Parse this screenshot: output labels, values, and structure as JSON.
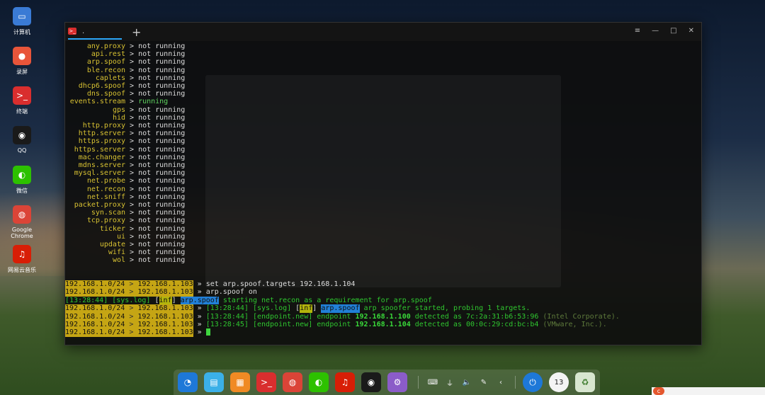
{
  "desktop_icons": [
    {
      "label": "计算机",
      "icon": "computer-icon",
      "color": "#3a7bd5"
    },
    {
      "label": "录屏",
      "icon": "screen-record-icon",
      "color": "#e8553a"
    },
    {
      "label": "终端",
      "icon": "terminal-icon",
      "color": "#d92e2e"
    },
    {
      "label": "QQ",
      "icon": "qq-icon",
      "color": "#1a1a1a"
    },
    {
      "label": "微信",
      "icon": "wechat-icon",
      "color": "#2dc100"
    },
    {
      "label": "Google Chrome",
      "icon": "chrome-icon",
      "color": "#db4437"
    },
    {
      "label": "网易云音乐",
      "icon": "netease-music-icon",
      "color": "#d81e06"
    }
  ],
  "terminal": {
    "tab_title": ".",
    "new_tab": "+",
    "controls": [
      "≡",
      "—",
      "□",
      "✕"
    ],
    "modules": [
      {
        "name": "any.proxy",
        "status": "not running"
      },
      {
        "name": "api.rest",
        "status": "not running"
      },
      {
        "name": "arp.spoof",
        "status": "not running"
      },
      {
        "name": "ble.recon",
        "status": "not running"
      },
      {
        "name": "caplets",
        "status": "not running"
      },
      {
        "name": "dhcp6.spoof",
        "status": "not running"
      },
      {
        "name": "dns.spoof",
        "status": "not running"
      },
      {
        "name": "events.stream",
        "status": "running"
      },
      {
        "name": "gps",
        "status": "not running"
      },
      {
        "name": "hid",
        "status": "not running"
      },
      {
        "name": "http.proxy",
        "status": "not running"
      },
      {
        "name": "http.server",
        "status": "not running"
      },
      {
        "name": "https.proxy",
        "status": "not running"
      },
      {
        "name": "https.server",
        "status": "not running"
      },
      {
        "name": "mac.changer",
        "status": "not running"
      },
      {
        "name": "mdns.server",
        "status": "not running"
      },
      {
        "name": "mysql.server",
        "status": "not running"
      },
      {
        "name": "net.probe",
        "status": "not running"
      },
      {
        "name": "net.recon",
        "status": "not running"
      },
      {
        "name": "net.sniff",
        "status": "not running"
      },
      {
        "name": "packet.proxy",
        "status": "not running"
      },
      {
        "name": "syn.scan",
        "status": "not running"
      },
      {
        "name": "tcp.proxy",
        "status": "not running"
      },
      {
        "name": "ticker",
        "status": "not running"
      },
      {
        "name": "ui",
        "status": "not running"
      },
      {
        "name": "update",
        "status": "not running"
      },
      {
        "name": "wifi",
        "status": "not running"
      },
      {
        "name": "wol",
        "status": "not running"
      }
    ],
    "prompt": {
      "net": "192.168.1.0/24",
      "gt": " > ",
      "ip": "192.168.1.103",
      "tail": " » "
    },
    "cmd1": "set arp.spoof.targets 192.168.1.104",
    "cmd2": "arp.spoof on",
    "log1": {
      "time": "[13:28:44]",
      "tag": "[sys.log]",
      "lb": "[",
      "inf": "inf",
      "rb": "]",
      "mod": "arp.spoof",
      "msg": " starting net.recon as a requirement for arp.spoof"
    },
    "log2": {
      "time": "[13:28:44]",
      "tag": "[sys.log]",
      "lb": "[",
      "inf": "inf",
      "rb": "]",
      "mod": "arp.spoof",
      "msg": " arp spoofer started, probing 1 targets."
    },
    "log3": {
      "time": "[13:28:44]",
      "tag": "[endpoint.new]",
      "pre": " endpoint ",
      "ip": "192.168.1.100",
      "mid": " detected as ",
      "mac": "7c:2a:31:b6:53:96",
      "vendor": " (Intel Corporate)."
    },
    "log4": {
      "time": "[13:28:45]",
      "tag": "[endpoint.new]",
      "pre": " endpoint ",
      "ip": "192.168.1.104",
      "mid": " detected as ",
      "mac": "00:0c:29:cd:bc:b4",
      "vendor": " (VMware, Inc.)."
    }
  },
  "dock": {
    "apps": [
      {
        "icon": "launcher-icon",
        "color": "#1e78d8"
      },
      {
        "icon": "file-manager-icon",
        "color": "#3bb0e8"
      },
      {
        "icon": "app-store-icon",
        "color": "#f08a24"
      },
      {
        "icon": "terminal-icon",
        "color": "#d92e2e"
      },
      {
        "icon": "chrome-icon",
        "color": "#db4437"
      },
      {
        "icon": "wechat-icon",
        "color": "#2dc100"
      },
      {
        "icon": "netease-music-icon",
        "color": "#d81e06"
      },
      {
        "icon": "qq-icon",
        "color": "#1a1a1a"
      },
      {
        "icon": "settings-icon",
        "color": "#8b5cc8"
      }
    ],
    "tray": [
      "⌨",
      "⏚",
      "🔈",
      "✎",
      "‹"
    ],
    "power_icon": "power-icon",
    "clock_text": "13",
    "trash_icon": "trash-icon"
  }
}
